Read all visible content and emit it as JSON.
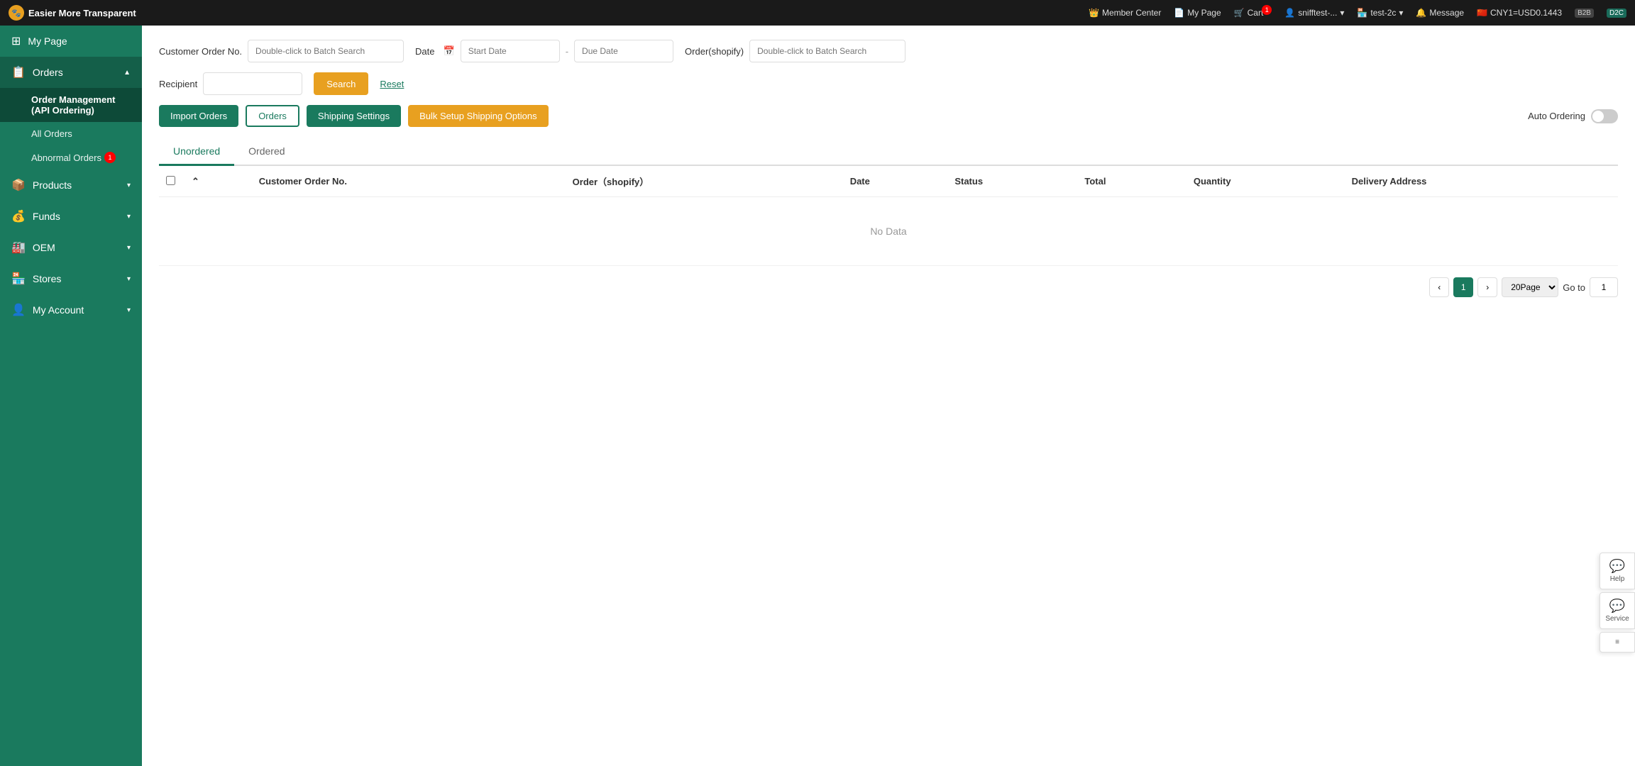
{
  "topnav": {
    "brand_name": "Easier More Transparent",
    "member_center": "Member Center",
    "my_page": "My Page",
    "cart": "Cart",
    "cart_count": "1",
    "user": "snifftest-...",
    "store": "test-2c",
    "message": "Message",
    "exchange_rate": "CNY1=USD0.1443",
    "tag_b2b": "B2B",
    "tag_d2c": "D2C"
  },
  "sidebar": {
    "my_page": "My Page",
    "orders": "Orders",
    "order_management": "Order Management (API Ordering)",
    "all_orders": "All Orders",
    "abnormal_orders": "Abnormal Orders",
    "abnormal_badge": "1",
    "products": "Products",
    "funds": "Funds",
    "oem": "OEM",
    "stores": "Stores",
    "my_account": "My Account"
  },
  "search": {
    "customer_order_no_label": "Customer Order No.",
    "customer_order_no_placeholder": "Double-click to Batch Search",
    "date_label": "Date",
    "start_date_placeholder": "Start Date",
    "end_date_placeholder": "Due Date",
    "order_shopify_label": "Order(shopify)",
    "order_shopify_placeholder": "Double-click to Batch Search",
    "recipient_label": "Recipient",
    "search_btn": "Search",
    "reset_btn": "Reset"
  },
  "actions": {
    "import_orders": "Import Orders",
    "orders": "Orders",
    "shipping_settings": "Shipping Settings",
    "bulk_setup": "Bulk Setup Shipping Options",
    "auto_ordering": "Auto Ordering"
  },
  "tabs": {
    "unordered": "Unordered",
    "ordered": "Ordered"
  },
  "table": {
    "columns": [
      "Customer Order No.",
      "Order（shopify）",
      "Date",
      "Status",
      "Total",
      "Quantity",
      "Delivery Address"
    ],
    "no_data": "No Data",
    "rows": []
  },
  "pagination": {
    "current_page": "1",
    "page_size": "20Page",
    "goto_label": "Go to",
    "goto_value": "1"
  },
  "floating": {
    "help": "Help",
    "service": "Service"
  }
}
